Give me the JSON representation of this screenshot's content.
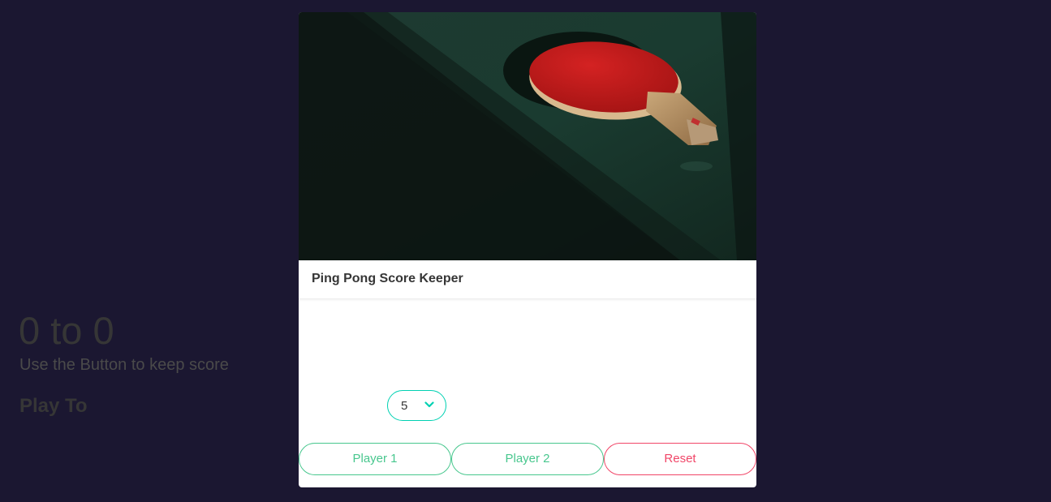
{
  "card": {
    "title": "Ping Pong Score Keeper",
    "image_description_icon": "ping-pong-paddle-image"
  },
  "score": {
    "text": "0 to 0",
    "subtitle": "Use the Button to keep score"
  },
  "play_to": {
    "label": "Play To",
    "selected": "5"
  },
  "buttons": {
    "player1": "Player 1",
    "player2": "Player 2",
    "reset": "Reset"
  },
  "colors": {
    "background": "#1b1731",
    "primary": "#00d1b2",
    "success": "#48c78e",
    "danger": "#f14668"
  }
}
